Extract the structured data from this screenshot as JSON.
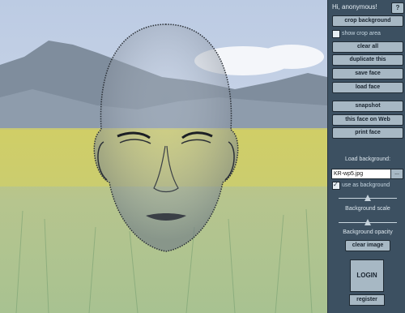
{
  "greeting": "Hi, anonymous!",
  "help_label": "?",
  "buttons": {
    "crop_background": "crop background",
    "clear_all": "clear all",
    "duplicate_this": "duplicate this",
    "save_face": "save face",
    "load_face": "load face",
    "snapshot": "snapshot",
    "this_face_on_web": "this face on Web",
    "print_face": "print face",
    "clear_image": "clear image",
    "login": "LOGIN",
    "register": "register",
    "browse": "..."
  },
  "show_crop_area": {
    "label": "show crop area",
    "checked": false
  },
  "load_background": {
    "label": "Load background:",
    "value": "KR-wp5.jpg"
  },
  "use_as_background": {
    "label": "use as background",
    "checked": true
  },
  "background_scale": {
    "label": "Background scale",
    "value": 0.5
  },
  "background_opacity": {
    "label": "Background opacity",
    "value": 0.5
  },
  "colors": {
    "panel": "#3c5061",
    "button": "#a7b8c4"
  }
}
